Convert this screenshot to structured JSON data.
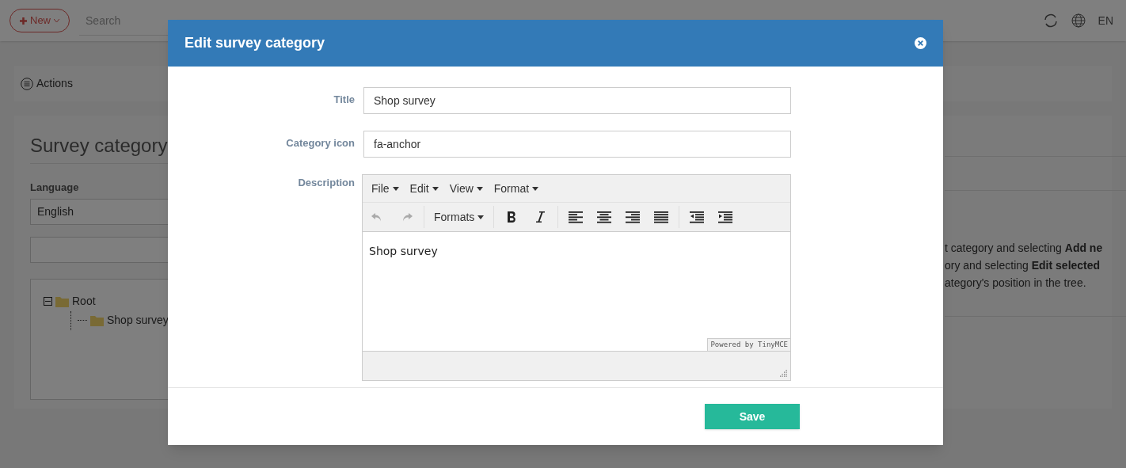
{
  "top_bar": {
    "new_button": "New",
    "search": {
      "placeholder": "Search"
    },
    "language": "EN"
  },
  "actions": {
    "label": "Actions"
  },
  "page": {
    "heading": "Survey category",
    "language_label": "Language",
    "language_value": "English",
    "tree": [
      {
        "label": "Root",
        "expanded": true,
        "children": [
          {
            "label": "Shop survey"
          }
        ]
      }
    ],
    "help_lines": [
      "t category and selecting **Add ne**",
      "ory and selecting **Edit selected**",
      "ategory's position in the tree."
    ]
  },
  "modal": {
    "title": "Edit survey category",
    "fields": [
      {
        "label": "Title",
        "value": "Shop survey"
      },
      {
        "label": "Category icon",
        "value": "fa-anchor"
      }
    ],
    "description": {
      "label": "Description",
      "menus": [
        "File",
        "Edit",
        "View",
        "Format"
      ],
      "history": [
        {
          "kind": "undo",
          "disabled": true
        },
        {
          "kind": "redo",
          "disabled": true
        }
      ],
      "formats": "Formats",
      "content": "Shop survey",
      "branding": "Powered by TinyMCE"
    },
    "save": "Save"
  }
}
